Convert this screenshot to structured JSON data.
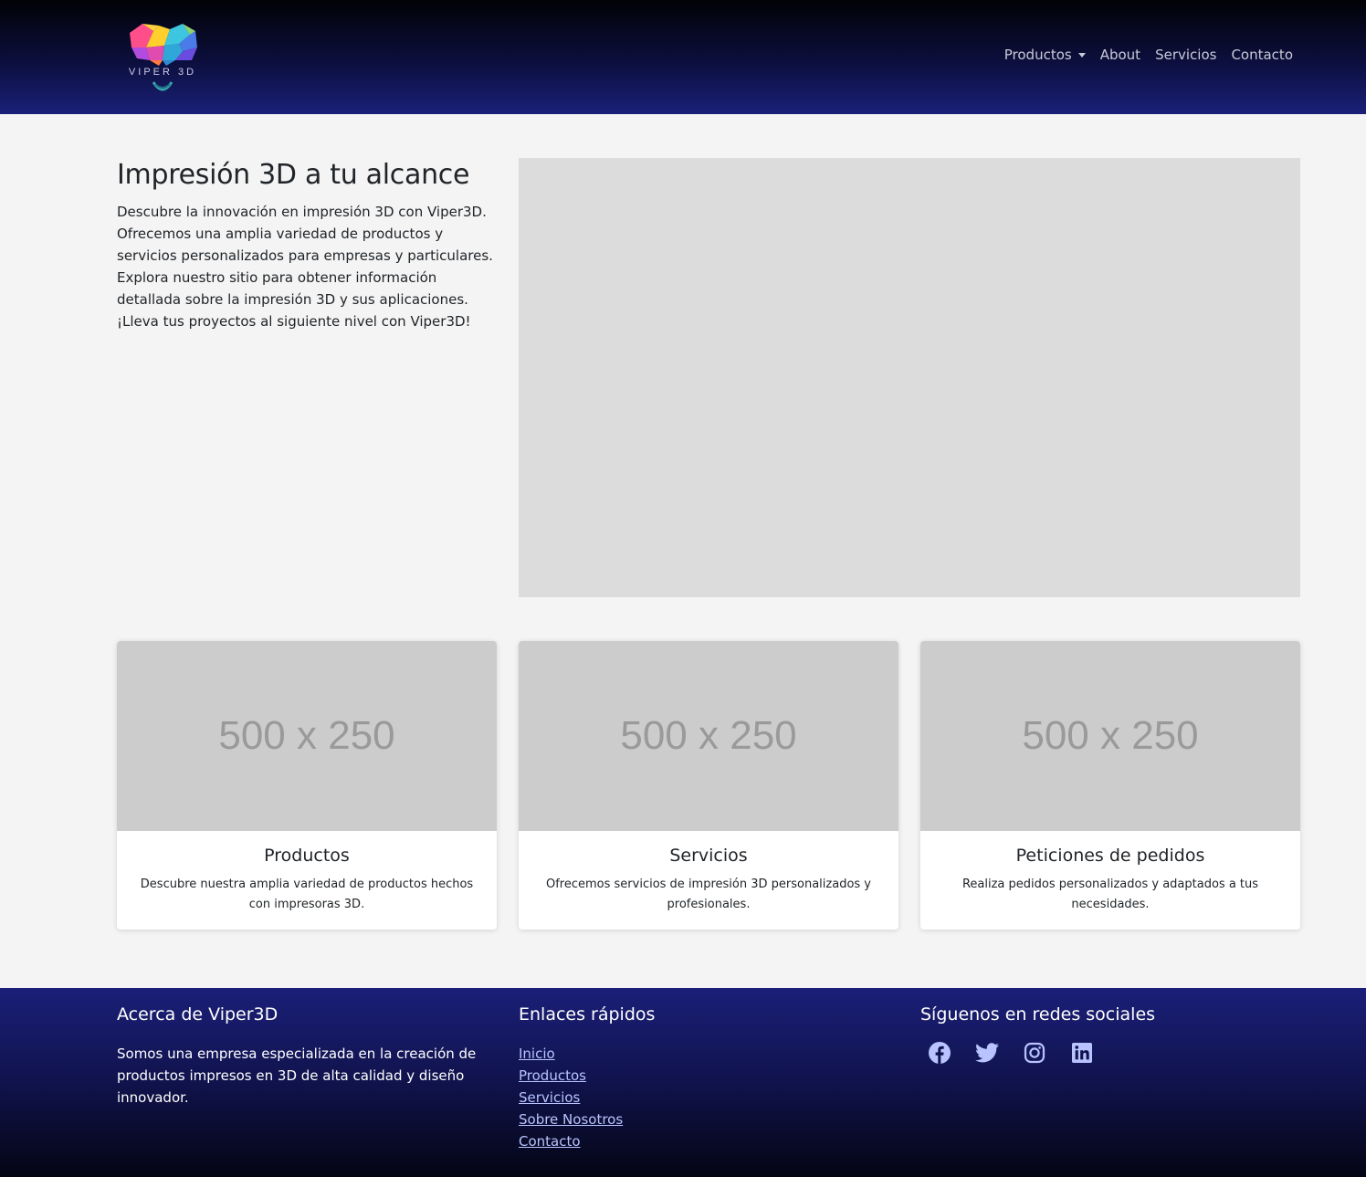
{
  "header": {
    "logo_text": "VIPER 3D",
    "nav": [
      {
        "label": "Productos",
        "dropdown": true
      },
      {
        "label": "About"
      },
      {
        "label": "Servicios"
      },
      {
        "label": "Contacto"
      }
    ]
  },
  "hero": {
    "title": "Impresión 3D a tu alcance",
    "text": "Descubre la innovación en impresión 3D con Viper3D. Ofrecemos una amplia variedad de productos y servicios personalizados para empresas y particulares. Explora nuestro sitio para obtener información detallada sobre la impresión 3D y sus aplicaciones. ¡Lleva tus proyectos al siguiente nivel con Viper3D!"
  },
  "cards": [
    {
      "placeholder": "500 x 250",
      "title": "Productos",
      "text": "Descubre nuestra amplia variedad de productos hechos con impresoras 3D."
    },
    {
      "placeholder": "500 x 250",
      "title": "Servicios",
      "text": "Ofrecemos servicios de impresión 3D personalizados y profesionales."
    },
    {
      "placeholder": "500 x 250",
      "title": "Peticiones de pedidos",
      "text": "Realiza pedidos personalizados y adaptados a tus necesidades."
    }
  ],
  "footer": {
    "about_title": "Acerca de Viper3D",
    "about_text": "Somos una empresa especializada en la creación de productos impresos en 3D de alta calidad y diseño innovador.",
    "links_title": "Enlaces rápidos",
    "links": [
      "Inicio",
      "Productos",
      "Servicios",
      "Sobre Nosotros",
      "Contacto"
    ],
    "social_title": "Síguenos en redes sociales",
    "social_icons": [
      "facebook-icon",
      "twitter-icon",
      "instagram-icon",
      "linkedin-icon"
    ]
  },
  "colors": {
    "navbar_bottom": "#1a2078",
    "footer_top": "#1b1f78",
    "link": "#b8c3ff",
    "page_bg": "#f4f4f4",
    "image_placeholder": "#dcdcdc",
    "card_placeholder": "#cccccc"
  }
}
